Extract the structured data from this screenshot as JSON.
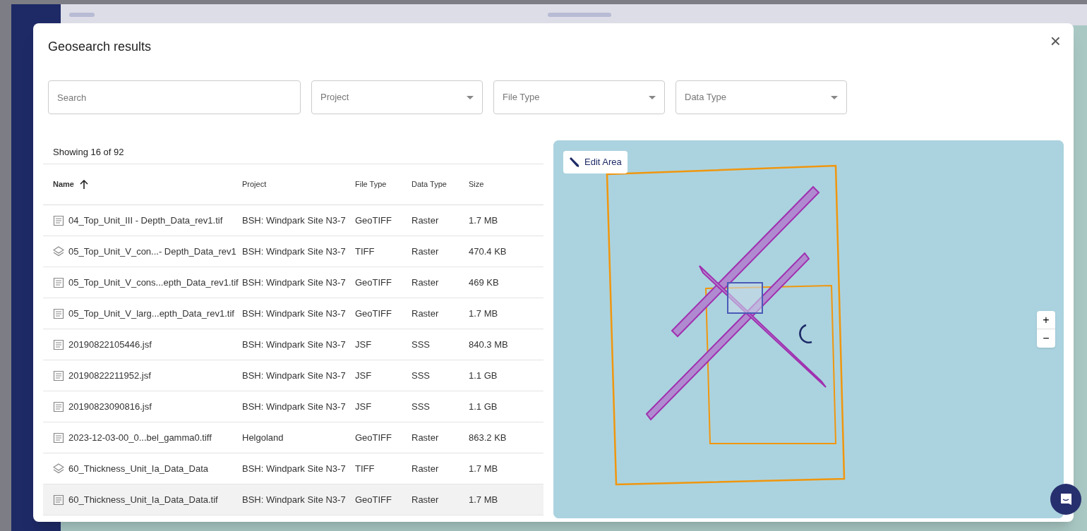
{
  "dialog": {
    "title": "Geosearch results",
    "close": "×"
  },
  "filters": {
    "search": {
      "placeholder": "Search"
    },
    "dropdowns": [
      {
        "placeholder": "Project"
      },
      {
        "placeholder": "File Type"
      },
      {
        "placeholder": "Data Type"
      }
    ]
  },
  "table": {
    "count": "Showing 16 of 92",
    "columns": [
      {
        "label": "Name",
        "sorted": true
      },
      {
        "label": "Project",
        "sorted": false
      },
      {
        "label": "File Type",
        "sorted": false
      },
      {
        "label": "Data Type",
        "sorted": false
      },
      {
        "label": "Size",
        "sorted": false
      }
    ],
    "rows": [
      {
        "kind": "file",
        "selected": false,
        "cells": [
          "04_Top_Unit_III - Depth_Data_rev1.tif",
          "BSH: Windpark Site N3-7",
          "GeoTIFF",
          "Raster",
          "1.7 MB"
        ]
      },
      {
        "kind": "layer",
        "selected": false,
        "cells": [
          "05_Top_Unit_V_con...- Depth_Data_rev1",
          "BSH: Windpark Site N3-7",
          "TIFF",
          "Raster",
          "470.4 KB"
        ]
      },
      {
        "kind": "file",
        "selected": false,
        "cells": [
          "05_Top_Unit_V_cons...epth_Data_rev1.tif",
          "BSH: Windpark Site N3-7",
          "GeoTIFF",
          "Raster",
          "469 KB"
        ]
      },
      {
        "kind": "file",
        "selected": false,
        "cells": [
          "05_Top_Unit_V_larg...epth_Data_rev1.tif",
          "BSH: Windpark Site N3-7",
          "GeoTIFF",
          "Raster",
          "1.7 MB"
        ]
      },
      {
        "kind": "file",
        "selected": false,
        "cells": [
          "20190822105446.jsf",
          "BSH: Windpark Site N3-7",
          "JSF",
          "SSS",
          "840.3 MB"
        ]
      },
      {
        "kind": "file",
        "selected": false,
        "cells": [
          "20190822211952.jsf",
          "BSH: Windpark Site N3-7",
          "JSF",
          "SSS",
          "1.1 GB"
        ]
      },
      {
        "kind": "file",
        "selected": false,
        "cells": [
          "20190823090816.jsf",
          "BSH: Windpark Site N3-7",
          "JSF",
          "SSS",
          "1.1 GB"
        ]
      },
      {
        "kind": "file",
        "selected": false,
        "cells": [
          "2023-12-03-00_0...bel_gamma0.tiff",
          "Helgoland",
          "GeoTIFF",
          "Raster",
          "863.2 KB"
        ]
      },
      {
        "kind": "layer",
        "selected": false,
        "cells": [
          "60_Thickness_Unit_Ia_Data_Data",
          "BSH: Windpark Site N3-7",
          "TIFF",
          "Raster",
          "1.7 MB"
        ]
      },
      {
        "kind": "file",
        "selected": true,
        "cells": [
          "60_Thickness_Unit_Ia_Data_Data.tif",
          "BSH: Windpark Site N3-7",
          "GeoTIFF",
          "Raster",
          "1.7 MB"
        ]
      }
    ]
  },
  "map": {
    "edit_button": "Edit Area",
    "zoom_in": "+",
    "zoom_out": "−"
  }
}
